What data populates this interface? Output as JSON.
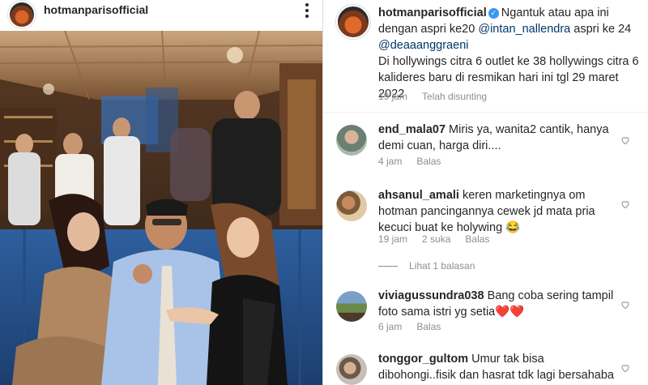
{
  "post": {
    "username": "hotmanparisofficial",
    "more_icon": "more-vertical-icon"
  },
  "caption": {
    "username": "hotmanparisofficial",
    "verified_icon": "verified-badge-icon",
    "text_1": "Ngantuk atau apa ini dengan aspri ke20 ",
    "mention_1": "@intan_nallendra",
    "text_2": " aspri ke 24 ",
    "mention_2": "@deaaanggraeni",
    "text_3": "Di hollywings citra 6 outlet ke 38 hollywings citra 6 kalideres baru di resmikan hari ini tgl 29 maret 2022",
    "time": "19 jam",
    "edited": "Telah disunting"
  },
  "comments": [
    {
      "username": "end_mala07",
      "text": " Miris ya, wanita2 cantik, hanya demi cuan, harga diri....",
      "time": "4 jam",
      "likes": "",
      "reply": "Balas"
    },
    {
      "username": "ahsanul_amali",
      "text": " keren marketingnya om hotman pancingannya cewek jd mata pria kecuci buat ke holywing 😂",
      "time": "19 jam",
      "likes": "2 suka",
      "reply": "Balas",
      "view_replies": "Lihat 1 balasan"
    },
    {
      "username": "viviagussundra038",
      "text": " Bang coba sering tampil foto sama istri yg setia❤️❤️",
      "time": "6 jam",
      "likes": "",
      "reply": "Balas"
    },
    {
      "username": "tonggor_gultom",
      "text": " Umur tak bisa dibohongi..fisik dan hasrat tdk lagi bersahaba",
      "time": "",
      "likes": "",
      "reply": ""
    }
  ],
  "colors": {
    "mention": "#00376b",
    "meta": "#8e8e8e",
    "verified": "#3897f0",
    "text": "#262626"
  }
}
